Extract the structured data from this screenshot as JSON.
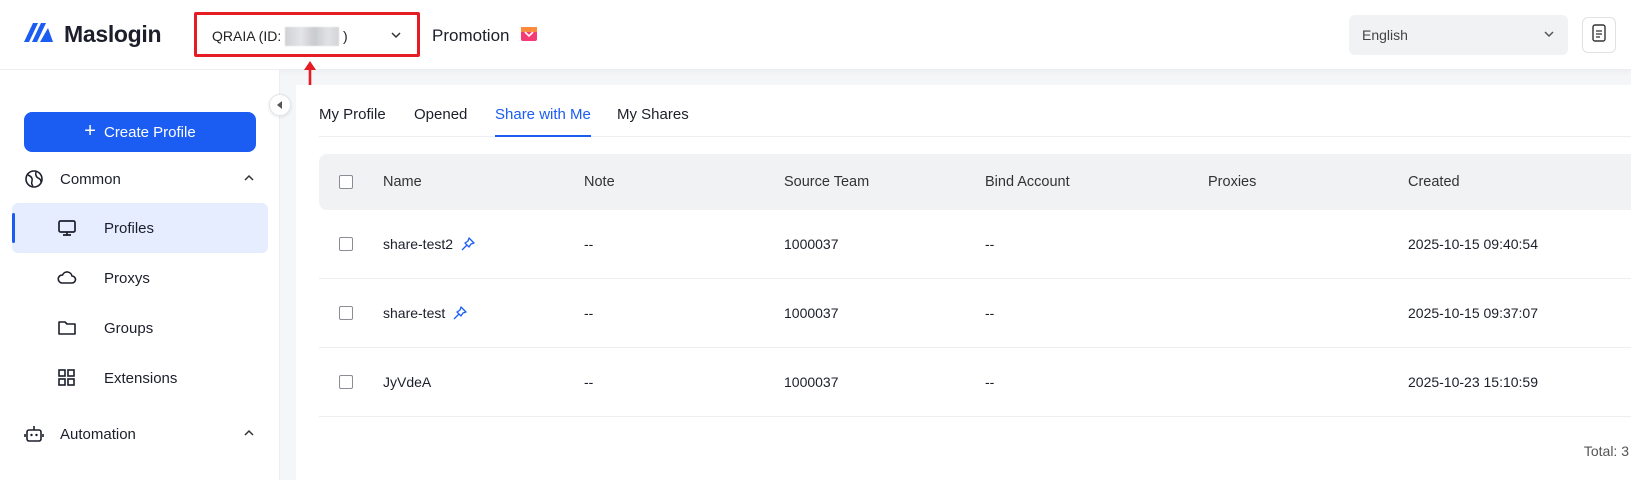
{
  "header": {
    "logo_text": "Maslogin",
    "team_select": {
      "label": "QRAIA (ID:",
      "id_redacted": true,
      "suffix": ")"
    },
    "promotion_label": "Promotion",
    "language_select": {
      "value": "English"
    },
    "icons": {
      "logo": "maslogin-logo-icon",
      "team_chevron": "chevron-down-icon",
      "promo": "gift-icon",
      "lang_chevron": "chevron-down-icon",
      "doc": "document-icon"
    },
    "annotation_color": "#e51c23"
  },
  "sidebar": {
    "create_button_label": "Create Profile",
    "groups": [
      {
        "label": "Common",
        "icon": "globe-icon",
        "expanded": true
      },
      {
        "label": "Automation",
        "icon": "robot-icon",
        "expanded": true
      }
    ],
    "items": [
      {
        "label": "Profiles",
        "icon": "monitor-icon",
        "active": true
      },
      {
        "label": "Proxys",
        "icon": "cloud-icon",
        "active": false
      },
      {
        "label": "Groups",
        "icon": "folder-icon",
        "active": false
      },
      {
        "label": "Extensions",
        "icon": "grid-icon",
        "active": false
      }
    ],
    "accent_color": "#1b5cf2"
  },
  "tabs": [
    {
      "label": "My Profile",
      "active": false
    },
    {
      "label": "Opened",
      "active": false
    },
    {
      "label": "Share with Me",
      "active": true
    },
    {
      "label": "My Shares",
      "active": false
    }
  ],
  "table": {
    "columns": [
      "Name",
      "Note",
      "Source Team",
      "Bind Account",
      "Proxies",
      "Created"
    ],
    "rows": [
      {
        "name": "share-test2",
        "pinned": true,
        "note": "--",
        "source_team": "1000037",
        "bind_account": "--",
        "proxies": "",
        "created": "2025-10-15 09:40:54"
      },
      {
        "name": "share-test",
        "pinned": true,
        "note": "--",
        "source_team": "1000037",
        "bind_account": "--",
        "proxies": "",
        "created": "2025-10-15 09:37:07"
      },
      {
        "name": "JyVdeA",
        "pinned": false,
        "note": "--",
        "source_team": "1000037",
        "bind_account": "--",
        "proxies": "",
        "created": "2025-10-23 15:10:59"
      }
    ],
    "total_label": "Total: 3"
  }
}
